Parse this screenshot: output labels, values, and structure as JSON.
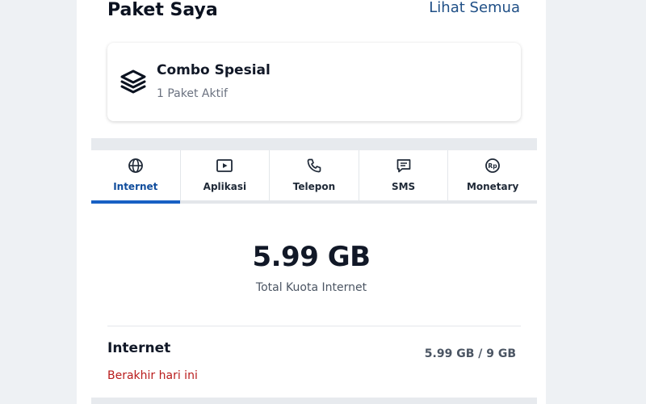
{
  "header": {
    "title": "Paket Saya",
    "see_all": "Lihat Semua"
  },
  "combo_card": {
    "title": "Combo Spesial",
    "subtitle": "1 Paket Aktif",
    "icon": "layers-icon"
  },
  "tabs": [
    {
      "label": "Internet",
      "icon": "globe-icon",
      "active": true
    },
    {
      "label": "Aplikasi",
      "icon": "play-screen-icon",
      "active": false
    },
    {
      "label": "Telepon",
      "icon": "phone-icon",
      "active": false
    },
    {
      "label": "SMS",
      "icon": "message-icon",
      "active": false
    },
    {
      "label": "Monetary",
      "icon": "rupiah-icon",
      "active": false
    }
  ],
  "quota": {
    "value": "5.99 GB",
    "label": "Total Kuota Internet"
  },
  "package_row": {
    "title": "Internet",
    "remaining": "5.99 GB",
    "total": "/ 9 GB",
    "expiry": "Berakhir hari ini"
  },
  "colors": {
    "accent": "#1760c4",
    "link": "#1f4f86",
    "warning": "#b91c1c"
  }
}
